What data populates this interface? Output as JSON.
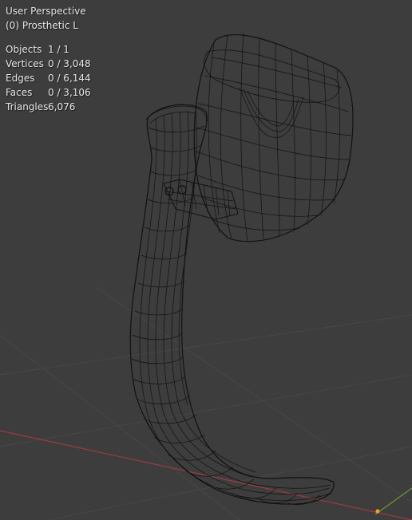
{
  "viewport": {
    "view_name": "User Perspective",
    "object_name": "(0) Prosthetic L",
    "stats": [
      {
        "label": "Objects",
        "value": "1 / 1"
      },
      {
        "label": "Vertices",
        "value": "0 / 3,048"
      },
      {
        "label": "Edges",
        "value": "0 / 6,144"
      },
      {
        "label": "Faces",
        "value": "0 / 3,106"
      },
      {
        "label": "Triangles",
        "value": "6,076"
      }
    ]
  },
  "colors": {
    "background": "#3d3d3d",
    "grid": "#474747",
    "x_axis": "#9c3b43",
    "y_axis": "#6f9a2c",
    "wire": "#111111",
    "origin": "#f0a030"
  }
}
